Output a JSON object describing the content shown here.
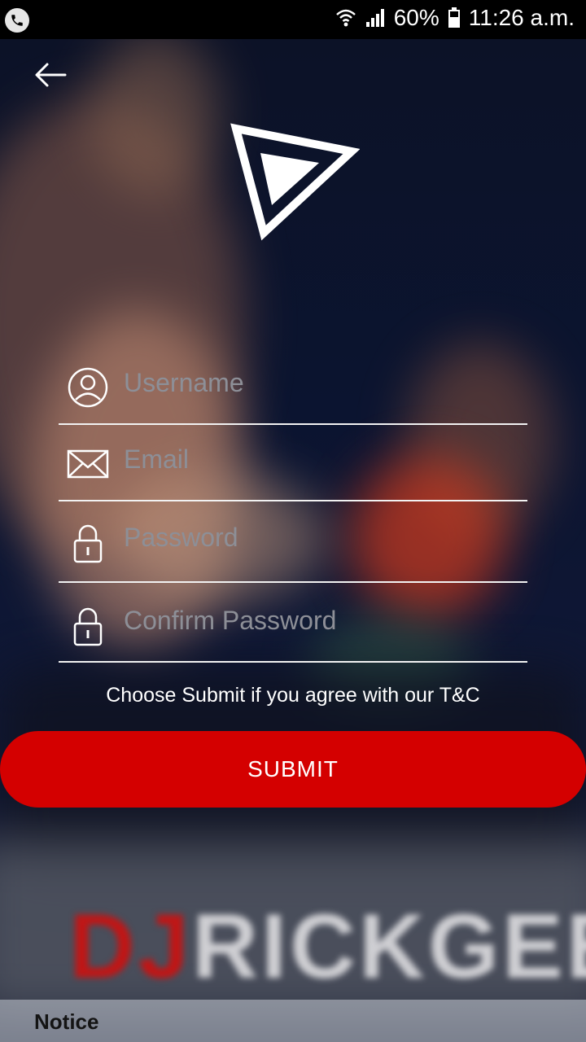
{
  "status_bar": {
    "battery": "60%",
    "time": "11:26 a.m."
  },
  "background": {
    "watermark_red": "DJ",
    "watermark_rest": "RICKGEEZ"
  },
  "form": {
    "username_placeholder": "Username",
    "email_placeholder": "Email",
    "password_placeholder": "Password",
    "confirm_password_placeholder": "Confirm Password",
    "terms_text": "Choose Submit if you agree with our T&C",
    "submit_label": "SUBMIT"
  },
  "notice": {
    "label": "Notice"
  },
  "colors": {
    "accent": "#d40000",
    "divider": "#f2f2f2",
    "placeholder": "#8d8f97"
  },
  "icons": [
    "phone-icon",
    "wifi-icon",
    "signal-icon",
    "battery-icon",
    "back-arrow-icon",
    "app-logo",
    "user-icon",
    "mail-icon",
    "lock-icon"
  ]
}
